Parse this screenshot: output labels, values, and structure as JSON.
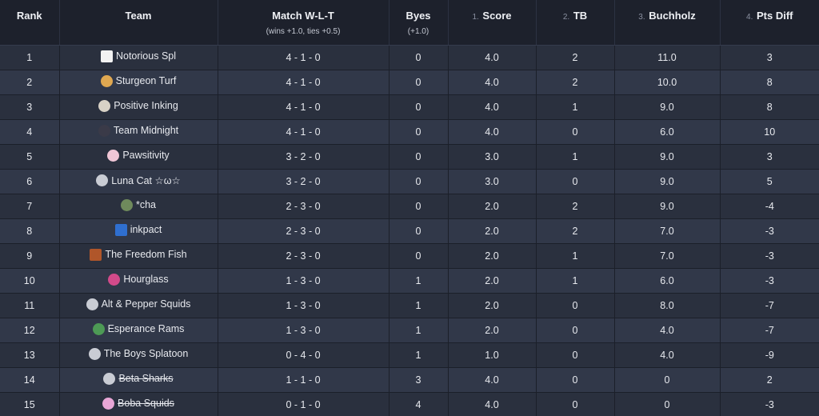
{
  "columns": {
    "rank": "Rank",
    "team": "Team",
    "match": "Match W-L-T",
    "match_sub": "(wins +1.0, ties +0.5)",
    "byes": "Byes",
    "byes_sub": "(+1.0)",
    "score_num": "1.",
    "score": "Score",
    "tb_num": "2.",
    "tb": "TB",
    "buchholz_num": "3.",
    "buchholz": "Buchholz",
    "ptsdiff_num": "4.",
    "ptsdiff": "Pts Diff"
  },
  "rows": [
    {
      "rank": "1",
      "team": "Notorious Spl",
      "wlt": "4 - 1 - 0",
      "byes": "0",
      "score": "4.0",
      "tb": "2",
      "buchholz": "11.0",
      "pts_diff": "3",
      "icon": "notorious-logo-icon",
      "icon_color": "#f2f2f2"
    },
    {
      "rank": "2",
      "team": "Sturgeon Turf",
      "wlt": "4 - 1 - 0",
      "byes": "0",
      "score": "4.0",
      "tb": "2",
      "buchholz": "10.0",
      "pts_diff": "8",
      "icon": "sturgeon-logo-icon",
      "icon_color": "#e0a851"
    },
    {
      "rank": "3",
      "team": "Positive Inking",
      "wlt": "4 - 1 - 0",
      "byes": "0",
      "score": "4.0",
      "tb": "1",
      "buchholz": "9.0",
      "pts_diff": "8",
      "icon": "positive-inking-logo-icon",
      "icon_color": "#d8d2c6"
    },
    {
      "rank": "4",
      "team": "Team Midnight",
      "wlt": "4 - 1 - 0",
      "byes": "0",
      "score": "4.0",
      "tb": "0",
      "buchholz": "6.0",
      "pts_diff": "10",
      "icon": "midnight-logo-icon",
      "icon_color": "#3a3a48"
    },
    {
      "rank": "5",
      "team": "Pawsitivity",
      "wlt": "3 - 2 - 0",
      "byes": "0",
      "score": "3.0",
      "tb": "1",
      "buchholz": "9.0",
      "pts_diff": "3",
      "icon": "pawsitivity-logo-icon",
      "icon_color": "#f0c6d6"
    },
    {
      "rank": "6",
      "team": "Luna Cat ☆ω☆",
      "wlt": "3 - 2 - 0",
      "byes": "0",
      "score": "3.0",
      "tb": "0",
      "buchholz": "9.0",
      "pts_diff": "5",
      "icon": "luna-cat-logo-icon",
      "icon_color": "#c9ccd4"
    },
    {
      "rank": "7",
      "team": "*cha",
      "wlt": "2 - 3 - 0",
      "byes": "0",
      "score": "2.0",
      "tb": "2",
      "buchholz": "9.0",
      "pts_diff": "-4",
      "icon": "cha-logo-icon",
      "icon_color": "#6f8a5c"
    },
    {
      "rank": "8",
      "team": "inkpact",
      "wlt": "2 - 3 - 0",
      "byes": "0",
      "score": "2.0",
      "tb": "2",
      "buchholz": "7.0",
      "pts_diff": "-3",
      "icon": "inkpact-logo-icon",
      "icon_color": "#2f6fd0"
    },
    {
      "rank": "9",
      "team": "The Freedom Fish",
      "wlt": "2 - 3 - 0",
      "byes": "0",
      "score": "2.0",
      "tb": "1",
      "buchholz": "7.0",
      "pts_diff": "-3",
      "icon": "freedom-fish-logo-icon",
      "icon_color": "#b0562a"
    },
    {
      "rank": "10",
      "team": "Hourglass",
      "wlt": "1 - 3 - 0",
      "byes": "1",
      "score": "2.0",
      "tb": "1",
      "buchholz": "6.0",
      "pts_diff": "-3",
      "icon": "hourglass-logo-icon",
      "icon_color": "#d24a8a"
    },
    {
      "rank": "11",
      "team": "Alt & Pepper Squids",
      "wlt": "1 - 3 - 0",
      "byes": "1",
      "score": "2.0",
      "tb": "0",
      "buchholz": "8.0",
      "pts_diff": "-7",
      "icon": "alt-pepper-logo-icon",
      "icon_color": "#c9ccd4"
    },
    {
      "rank": "12",
      "team": "Esperance Rams",
      "wlt": "1 - 3 - 0",
      "byes": "1",
      "score": "2.0",
      "tb": "0",
      "buchholz": "4.0",
      "pts_diff": "-7",
      "icon": "esperance-rams-logo-icon",
      "icon_color": "#4d9a55"
    },
    {
      "rank": "13",
      "team": "The Boys Splatoon",
      "wlt": "0 - 4 - 0",
      "byes": "1",
      "score": "1.0",
      "tb": "0",
      "buchholz": "4.0",
      "pts_diff": "-9",
      "icon": "boys-splatoon-logo-icon",
      "icon_color": "#c9ccd4"
    },
    {
      "rank": "14",
      "team": "Beta Sharks",
      "wlt": "1 - 1 - 0",
      "byes": "3",
      "score": "4.0",
      "tb": "0",
      "buchholz": "0",
      "pts_diff": "2",
      "icon": "beta-sharks-logo-icon",
      "icon_color": "#c9ccd4",
      "dropped": true
    },
    {
      "rank": "15",
      "team": "Boba Squids",
      "wlt": "0 - 1 - 0",
      "byes": "4",
      "score": "4.0",
      "tb": "0",
      "buchholz": "0",
      "pts_diff": "-3",
      "icon": "boba-squids-logo-icon",
      "icon_color": "#e8a6d6",
      "dropped": true
    }
  ]
}
